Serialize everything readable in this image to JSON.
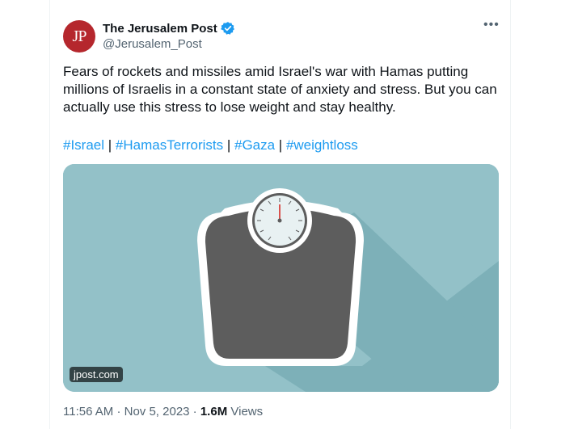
{
  "account": {
    "display_name": "The Jerusalem Post",
    "handle": "@Jerusalem_Post",
    "avatar_initials": "JP",
    "avatar_color": "#b5272d",
    "verified": true
  },
  "tweet": {
    "text": "Fears of rockets and missiles amid Israel's war with Hamas putting millions of Israelis in a constant state of anxiety and stress. But you can actually use this stress to lose weight and stay healthy.",
    "hashtags": [
      "#Israel",
      "#HamasTerrorists",
      "#Gaza",
      "#weightloss"
    ],
    "separator": " | "
  },
  "media": {
    "source_label": "jpost.com",
    "background_color": "#93c1c8",
    "icon": "bathroom-scale"
  },
  "meta": {
    "time": "11:56 AM",
    "date": "Nov 5, 2023",
    "views_count": "1.6M",
    "views_label": "Views"
  },
  "colors": {
    "link": "#1d9bf0",
    "secondary_text": "#536471"
  }
}
